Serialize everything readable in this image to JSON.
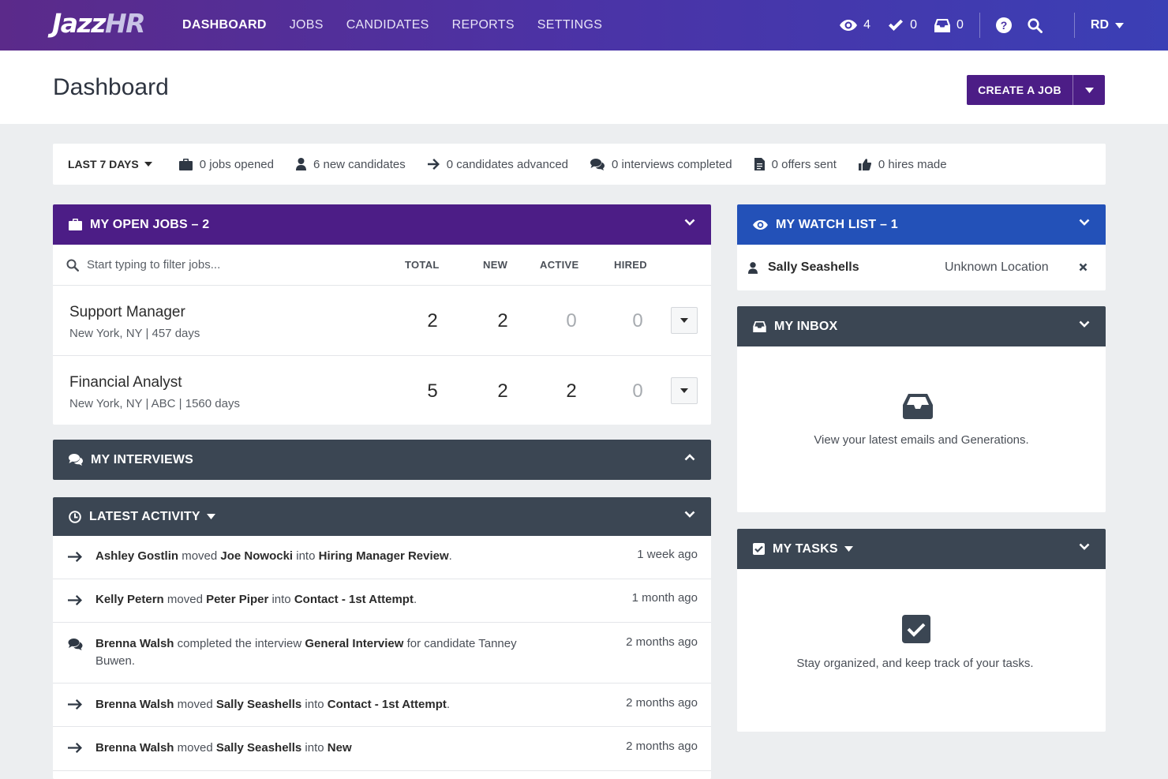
{
  "nav": {
    "logo_main": "Jazz",
    "logo_hr": "HR",
    "links": [
      "DASHBOARD",
      "JOBS",
      "CANDIDATES",
      "REPORTS",
      "SETTINGS"
    ],
    "watch_count": "4",
    "check_count": "0",
    "inbox_count": "0",
    "user_initials": "RD"
  },
  "header": {
    "title": "Dashboard",
    "create_label": "CREATE A JOB"
  },
  "stats": {
    "period": "LAST 7 DAYS",
    "jobs_opened": "0 jobs opened",
    "new_candidates": "6 new candidates",
    "advanced": "0 candidates advanced",
    "interviews": "0 interviews completed",
    "offers": "0 offers sent",
    "hires": "0 hires made"
  },
  "open_jobs": {
    "title": "MY OPEN JOBS – 2",
    "filter_placeholder": "Start typing to filter jobs...",
    "columns": [
      "TOTAL",
      "NEW",
      "ACTIVE",
      "HIRED"
    ],
    "jobs": [
      {
        "title": "Support Manager",
        "meta": "New York, NY  |  457 days",
        "total": "2",
        "new": "2",
        "active": "0",
        "hired": "0"
      },
      {
        "title": "Financial Analyst",
        "meta": "New York, NY  |  ABC  |  1560 days",
        "total": "5",
        "new": "2",
        "active": "2",
        "hired": "0"
      }
    ]
  },
  "interviews": {
    "title": "MY INTERVIEWS"
  },
  "activity": {
    "title": "LATEST ACTIVITY",
    "items": [
      {
        "icon": "arrow-right-icon",
        "actor": "Ashley Gostlin",
        "verb": " moved ",
        "subject": "Joe Nowocki",
        "prep": " into ",
        "target": "Hiring Manager Review",
        "tail": ".",
        "time": "1 week ago"
      },
      {
        "icon": "arrow-right-icon",
        "actor": "Kelly Petern",
        "verb": " moved ",
        "subject": "Peter Piper",
        "prep": " into ",
        "target": "Contact - 1st Attempt",
        "tail": ".",
        "time": "1 month ago"
      },
      {
        "icon": "comments-icon",
        "actor": "Brenna Walsh",
        "verb": " completed the interview ",
        "subject": "General Interview",
        "prep": " for candidate Tanney Buwen.",
        "target": "",
        "tail": "",
        "time": "2 months ago"
      },
      {
        "icon": "arrow-right-icon",
        "actor": "Brenna Walsh",
        "verb": " moved ",
        "subject": "Sally Seashells",
        "prep": " into ",
        "target": "Contact - 1st Attempt",
        "tail": ".",
        "time": "2 months ago"
      },
      {
        "icon": "arrow-right-icon",
        "actor": "Brenna Walsh",
        "verb": " moved ",
        "subject": "Sally Seashells",
        "prep": " into ",
        "target": "New",
        "tail": "",
        "time": "2 months ago"
      }
    ]
  },
  "watch_list": {
    "title": "MY WATCH LIST – 1",
    "name": "Sally Seashells",
    "location": "Unknown Location"
  },
  "inbox": {
    "title": "MY INBOX",
    "empty_text": "View your latest emails and Generations."
  },
  "tasks": {
    "title": "MY TASKS",
    "empty_text": "Stay organized, and keep track of your tasks."
  },
  "colors": {
    "purple": "#4c1d86",
    "blue": "#2351b8",
    "slate": "#3b4653"
  }
}
